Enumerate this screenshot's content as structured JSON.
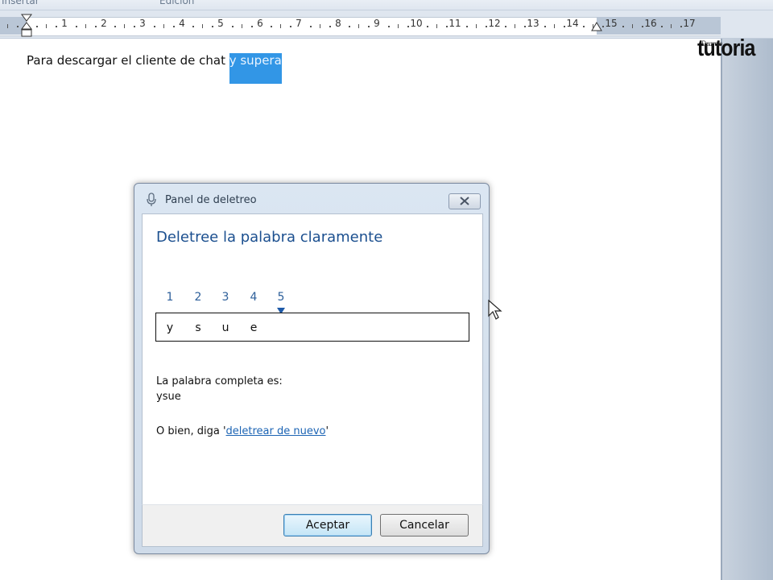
{
  "ribbon": {
    "group_left": "Insertar",
    "group_mid": "Edición"
  },
  "ruler": {
    "numbers": [
      "1",
      "2",
      "3",
      "4",
      "5",
      "6",
      "7",
      "8",
      "9",
      "10",
      "11",
      "12",
      "13",
      "14",
      "15",
      "16",
      "17"
    ]
  },
  "logo": {
    "script": "Desarrollo",
    "text": "tutoria"
  },
  "document": {
    "text_before": "Para descargar el cliente de chat ",
    "selected_text": "y supera"
  },
  "dialog": {
    "title": "Panel de deletreo",
    "heading": "Deletree la palabra claramente",
    "positions": [
      "1",
      "2",
      "3",
      "4",
      "5"
    ],
    "letters": [
      "y",
      "s",
      "u",
      "e"
    ],
    "complete_label": "La palabra completa es:",
    "complete_word": "ysue",
    "alt_prefix": "O bien, diga '",
    "alt_link": "deletrear de nuevo",
    "alt_suffix": "'",
    "ok_label": "Aceptar",
    "cancel_label": "Cancelar"
  }
}
